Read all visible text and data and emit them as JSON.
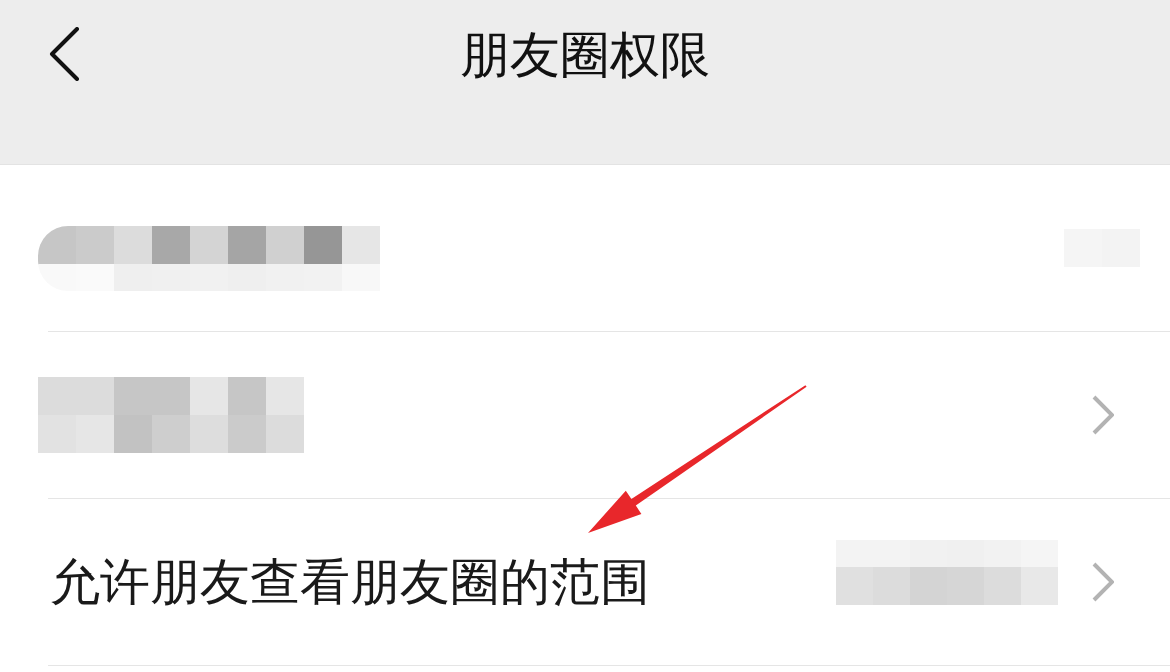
{
  "header": {
    "title": "朋友圈权限",
    "back": true
  },
  "rows": [
    {
      "kind": "redacted",
      "value_redacted": true,
      "chevron": false,
      "arrow": false
    },
    {
      "kind": "redacted",
      "value_redacted": false,
      "chevron": true,
      "arrow": false
    },
    {
      "kind": "text",
      "label": "允许朋友查看朋友圈的范围",
      "value_redacted": true,
      "chevron": true,
      "arrow": true
    }
  ]
}
